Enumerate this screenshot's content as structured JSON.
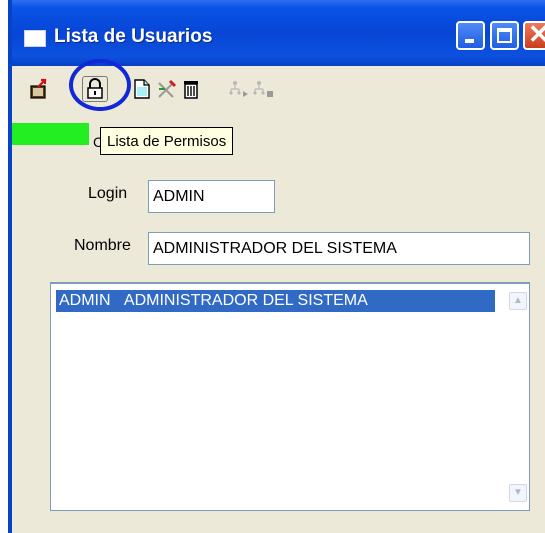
{
  "window": {
    "title": "Lista de Usuarios",
    "controls": {
      "minimize": "minimize",
      "maximize": "maximize",
      "close": "close"
    }
  },
  "toolbar": {
    "buttons": [
      {
        "icon": "exit-icon",
        "enabled": true
      },
      {
        "icon": "lock-icon",
        "enabled": true,
        "highlighted": true
      },
      {
        "icon": "new-document-icon",
        "enabled": true
      },
      {
        "icon": "edit-tools-icon",
        "enabled": true
      },
      {
        "icon": "trash-icon",
        "enabled": true
      },
      {
        "icon": "tree-forward-icon",
        "enabled": false
      },
      {
        "icon": "tree-stop-icon",
        "enabled": false
      }
    ],
    "tooltip": "Lista de Permisos"
  },
  "status_fragment": "Co",
  "form": {
    "login_label": "Login",
    "login_value": "ADMIN",
    "nombre_label": "Nombre",
    "nombre_value": "ADMINISTRADOR DEL SISTEMA"
  },
  "users_list": {
    "rows": [
      {
        "login": "ADMIN",
        "nombre": "ADMINISTRADOR DEL SISTEMA",
        "selected": true
      }
    ]
  },
  "colors": {
    "titlebar": "#0746d6",
    "selection": "#316ac5",
    "status_green": "#22ee22",
    "highlight_ring": "#1028d8",
    "window_bg": "#ece9d8"
  }
}
